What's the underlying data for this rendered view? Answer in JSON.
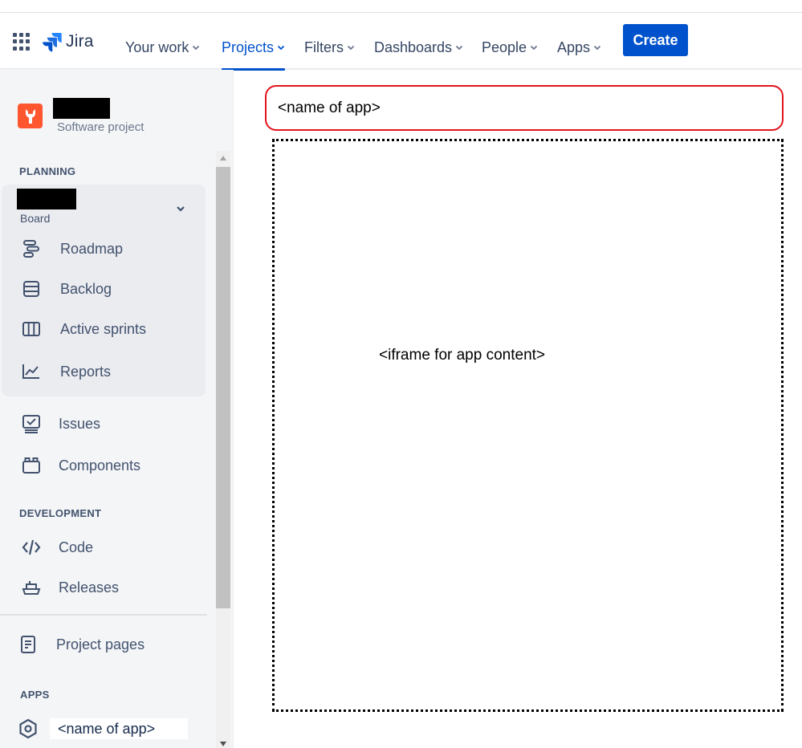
{
  "topnav": {
    "logo_text": "Jira",
    "items": [
      {
        "label": "Your work",
        "active": false
      },
      {
        "label": "Projects",
        "active": true
      },
      {
        "label": "Filters",
        "active": false
      },
      {
        "label": "Dashboards",
        "active": false
      },
      {
        "label": "People",
        "active": false
      },
      {
        "label": "Apps",
        "active": false
      }
    ],
    "create_label": "Create",
    "accent_color": "#0052cc"
  },
  "sidebar": {
    "project_type": "Software project",
    "planning_heading": "PLANNING",
    "board_sub": "Board",
    "planning_items": [
      {
        "label": "Roadmap",
        "icon": "roadmap-icon"
      },
      {
        "label": "Backlog",
        "icon": "backlog-icon"
      },
      {
        "label": "Active sprints",
        "icon": "active-sprints-icon"
      },
      {
        "label": "Reports",
        "icon": "reports-icon"
      }
    ],
    "other_items": [
      {
        "label": "Issues",
        "icon": "issues-icon"
      },
      {
        "label": "Components",
        "icon": "components-icon"
      }
    ],
    "development_heading": "DEVELOPMENT",
    "development_items": [
      {
        "label": "Code",
        "icon": "code-icon"
      },
      {
        "label": "Releases",
        "icon": "releases-icon"
      }
    ],
    "project_pages_label": "Project pages",
    "apps_heading": "APPS",
    "app_item_label": "<name of app>"
  },
  "main": {
    "app_name": "<name of app>",
    "iframe_text": "<iframe for app content>",
    "highlight_color": "#e3141c"
  }
}
